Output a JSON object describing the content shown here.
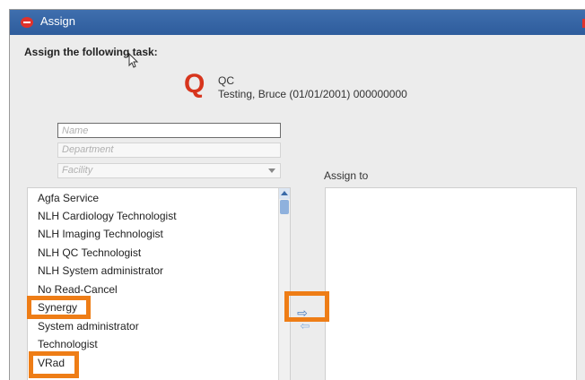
{
  "window": {
    "title": "Assign"
  },
  "dialog": {
    "heading": "Assign the following task:"
  },
  "task": {
    "icon_letter": "Q",
    "name": "QC",
    "patient": "Testing, Bruce (01/01/2001) 000000000"
  },
  "filters": {
    "name_placeholder": "Name",
    "department_placeholder": "Department",
    "facility_placeholder": "Facility"
  },
  "assign_to_label": "Assign to",
  "available_list": [
    "Agfa Service",
    "NLH Cardiology Technologist",
    "NLH Imaging Technologist",
    "NLH QC Technologist",
    "NLH System administrator",
    "No Read-Cancel",
    "Synergy",
    "System administrator",
    "Technologist",
    "VRad"
  ],
  "buttons": {
    "move_right": "⇨",
    "move_left": "⇦"
  },
  "highlight_color": "#ee7d16",
  "icons": [
    "app-logo-icon",
    "cursor-icon",
    "dropdown-arrow-icon",
    "scroll-up-icon",
    "arrow-right-icon",
    "arrow-left-icon"
  ]
}
